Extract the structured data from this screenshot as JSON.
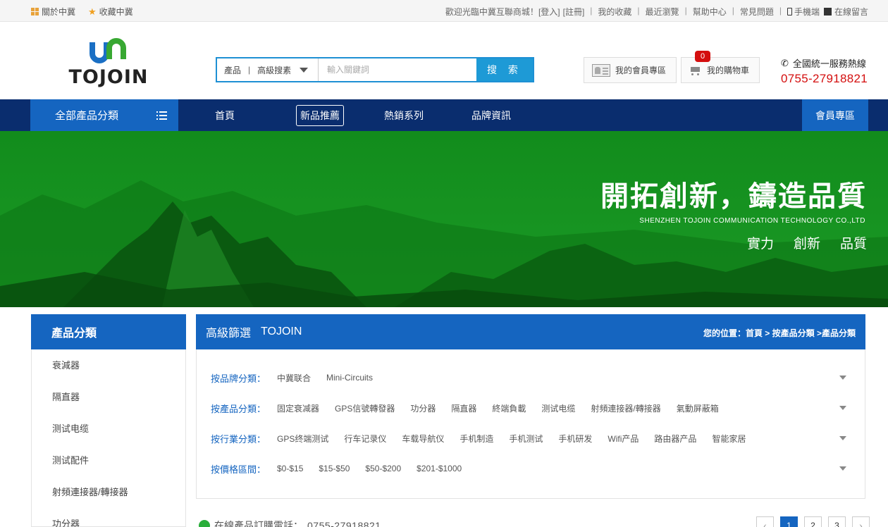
{
  "topbar": {
    "about": "關於中冀",
    "favorite": "收藏中冀",
    "welcome": "歡迎光臨中冀互聯商城！",
    "login": "[登入]",
    "register": "[註冊]",
    "links": [
      "我的收藏",
      "最近瀏覽",
      "幫助中心",
      "常見問題"
    ],
    "mobile": "手機端",
    "message": "在線留言"
  },
  "logo": {
    "name": "TOJOIN"
  },
  "search": {
    "category": "產品",
    "advanced": "高級搜素",
    "placeholder": "輸入關鍵詞",
    "button": "搜 索"
  },
  "header": {
    "member_label": "我的會員專區",
    "cart_label": "我的購物車",
    "cart_count": "0",
    "hotline_title": "全國統一服務熱線",
    "hotline_number": "0755-27918821"
  },
  "nav": {
    "all_categories": "全部產品分類",
    "items": [
      "首頁",
      "新品推薦",
      "熱銷系列",
      "品牌資訊"
    ],
    "member_zone": "會員專區"
  },
  "banner": {
    "headline": "開拓創新，鑄造品質",
    "company": "SHENZHEN TOJOIN COMMUNICATION TECHNOLOGY CO.,LTD",
    "motto": [
      "實力",
      "創新",
      "品質"
    ]
  },
  "sidebar": {
    "title": "產品分類",
    "items": [
      "衰減器",
      "隔直器",
      "测试电缆",
      "测试配件",
      "射頻連接器/轉接器",
      "功分器"
    ]
  },
  "filter": {
    "title": "高級篩選",
    "brand": "TOJOIN",
    "breadcrumb": "您的位置：首頁 > 按產品分類 >產品分類",
    "rows": [
      {
        "label": "按品牌分類：",
        "options": [
          "中冀联合",
          "Mini-Circuits"
        ]
      },
      {
        "label": "按產品分類：",
        "options": [
          "固定衰减器",
          "GPS信號轉發器",
          "功分器",
          "隔直器",
          "終端負載",
          "测试电缆",
          "射頻連接器/轉接器",
          "氣動屏蔽箱"
        ]
      },
      {
        "label": "按行業分類：",
        "options": [
          "GPS终端测试",
          "行车记录仪",
          "车载导航仪",
          "手机制造",
          "手机测试",
          "手机研发",
          "Wifi产品",
          "路由器产品",
          "智能家居"
        ]
      },
      {
        "label": "按價格區間：",
        "options": [
          "$0-$15",
          "$15-$50",
          "$50-$200",
          "$201-$1000"
        ]
      }
    ]
  },
  "bottom": {
    "order_label": "在線產品訂購電話：",
    "order_number": "0755-27918821"
  },
  "pager": {
    "pages": [
      "1",
      "2",
      "3"
    ],
    "prev": "‹",
    "next": "›"
  },
  "colors": {
    "primary": "#1565c0",
    "nav": "#0a2d6e",
    "accent_red": "#d40f0f",
    "banner_green": "#178f22"
  }
}
